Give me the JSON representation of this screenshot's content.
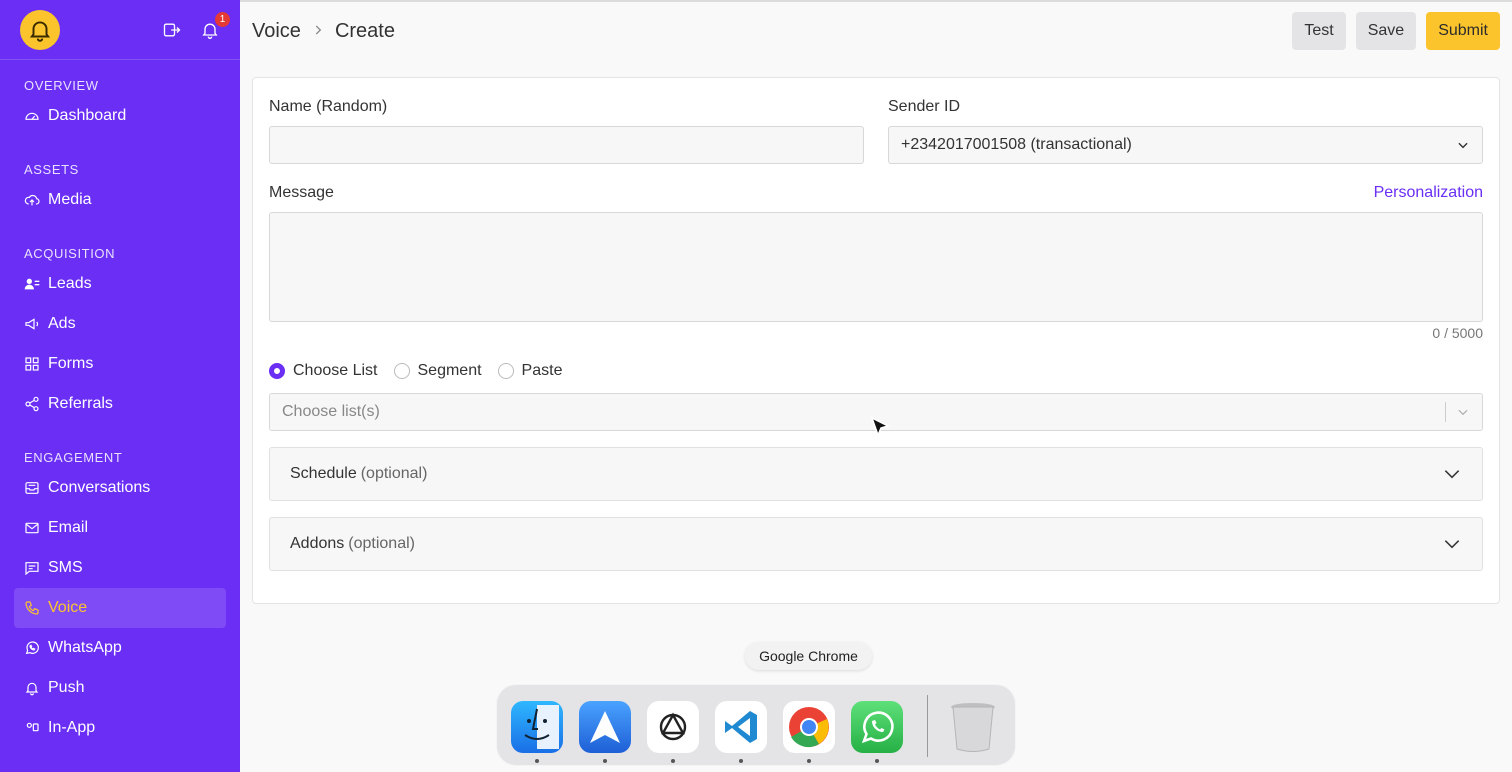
{
  "sidebar": {
    "notification_count": "1",
    "sections": {
      "overview": "OVERVIEW",
      "assets": "ASSETS",
      "acquisition": "ACQUISITION",
      "engagement": "ENGAGEMENT"
    },
    "items": {
      "dashboard": "Dashboard",
      "media": "Media",
      "leads": "Leads",
      "ads": "Ads",
      "forms": "Forms",
      "referrals": "Referrals",
      "conversations": "Conversations",
      "email": "Email",
      "sms": "SMS",
      "voice": "Voice",
      "whatsapp": "WhatsApp",
      "push": "Push",
      "inapp": "In-App"
    },
    "colors": {
      "background": "#6a2ef5",
      "active": "#fcc42c"
    }
  },
  "header": {
    "breadcrumb_parent": "Voice",
    "breadcrumb_current": "Create",
    "test_label": "Test",
    "save_label": "Save",
    "submit_label": "Submit"
  },
  "form": {
    "name_label": "Name (Random)",
    "name_value": "",
    "sender_label": "Sender ID",
    "sender_value": "+2342017001508 (transactional)",
    "message_label": "Message",
    "personalization_link": "Personalization",
    "message_value": "",
    "counter": "0 / 5000",
    "radio_options": [
      "Choose List",
      "Segment",
      "Paste"
    ],
    "selected_radio": "Choose List",
    "list_placeholder": "Choose list(s)",
    "schedule_label": "Schedule",
    "schedule_optional": "(optional)",
    "addons_label": "Addons",
    "addons_optional": "(optional)"
  },
  "dock": {
    "tooltip": "Google Chrome",
    "apps": [
      "finder-icon",
      "spark-icon",
      "chatgpt-icon",
      "vscode-icon",
      "chrome-icon",
      "whatsapp-icon",
      "trash-icon"
    ]
  }
}
